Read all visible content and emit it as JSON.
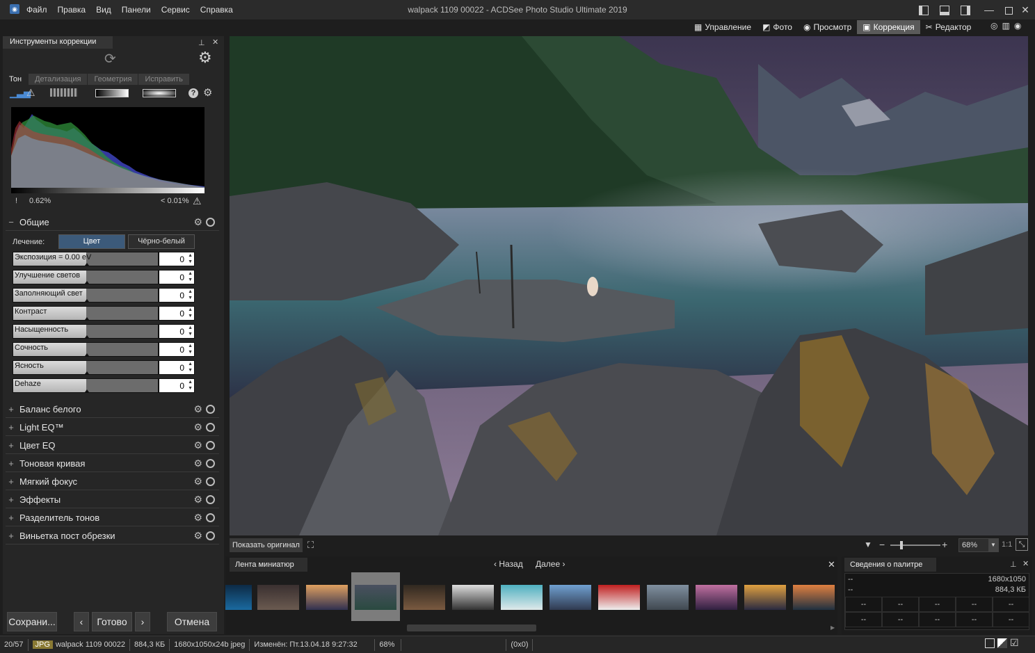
{
  "window": {
    "title": "walpack 1109 00022 - ACDSee Photo Studio Ultimate 2019",
    "menu": [
      "Файл",
      "Правка",
      "Вид",
      "Панели",
      "Сервис",
      "Справка"
    ]
  },
  "modes": [
    {
      "label": "Управление",
      "icon": "grid-icon"
    },
    {
      "label": "Фото",
      "icon": "photos-icon"
    },
    {
      "label": "Просмотр",
      "icon": "eye-icon"
    },
    {
      "label": "Коррекция",
      "icon": "develop-icon",
      "active": true
    },
    {
      "label": "Редактор",
      "icon": "edit-tools-icon"
    }
  ],
  "left_panel": {
    "title": "Инструменты коррекции",
    "tabs": [
      "Тон",
      "Детализация",
      "Геометрия",
      "Исправить"
    ],
    "active_tab": "Тон",
    "histogram": {
      "clip_low": "0.62%",
      "clip_high": "< 0.01%"
    },
    "general": {
      "title": "Общие",
      "treatment_label": "Лечение:",
      "treatment_options": [
        "Цвет",
        "Чёрно-белый"
      ],
      "treatment_selected": "Цвет",
      "sliders": [
        {
          "label": "Экспозиция = 0.00 eV",
          "value": "0"
        },
        {
          "label": "Улучшение светов",
          "value": "0"
        },
        {
          "label": "Заполняющий свет",
          "value": "0"
        },
        {
          "label": "Контраст",
          "value": "0"
        },
        {
          "label": "Насыщенность",
          "value": "0"
        },
        {
          "label": "Сочность",
          "value": "0"
        },
        {
          "label": "Ясность",
          "value": "0"
        },
        {
          "label": "Dehaze",
          "value": "0"
        }
      ]
    },
    "sections": [
      "Баланс белого",
      "Light EQ™",
      "Цвет EQ",
      "Тоновая кривая",
      "Мягкий фокус",
      "Эффекты",
      "Разделитель тонов",
      "Виньетка пост обрезки"
    ],
    "buttons": {
      "save": "Сохрани...",
      "done": "Готово",
      "cancel": "Отмена"
    }
  },
  "viewer": {
    "show_original": "Показать оригинал",
    "zoom": "68%",
    "ratio": "1:1"
  },
  "filmstrip": {
    "title": "Лента миниатюр",
    "back": "Назад",
    "next": "Далее",
    "selected_index": 2
  },
  "palette_info": {
    "title": "Сведения о палитре",
    "row1_left": "--",
    "row1_right": "1680x1050",
    "row2_left": "--",
    "row2_right": "884,3 КБ",
    "cell": "--"
  },
  "status": {
    "position": "20/57",
    "format": "JPG",
    "filename": "walpack 1109 00022",
    "size": "884,3 КБ",
    "dims": "1680x1050x24b jpeg",
    "modified": "Изменён: Пт.13.04.18 9:27:32",
    "zoom": "68%",
    "coords": "(0x0)"
  }
}
